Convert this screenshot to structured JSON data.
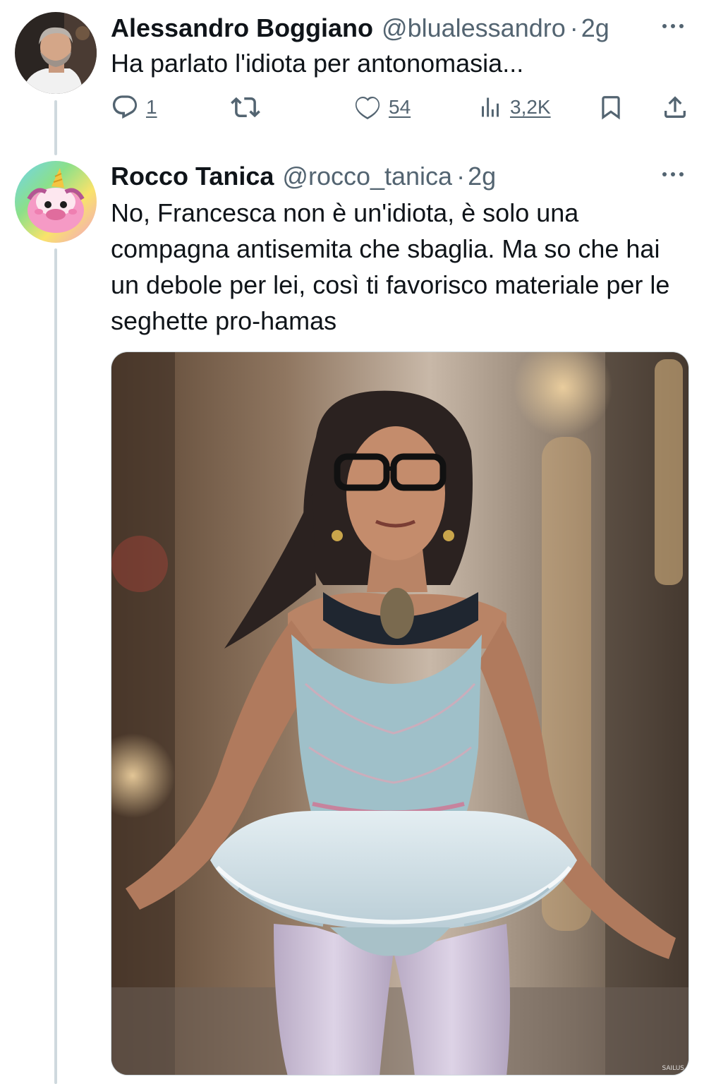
{
  "tweet_parent": {
    "author_name": "Alessandro Boggiano",
    "author_handle": "@blualessandro",
    "separator": "·",
    "time": "2g",
    "text": "Ha parlato l'idiota per antonomasia...",
    "avatar_icon": "avatar-photo-man",
    "more_icon": "more-horizontal-icon",
    "actions": {
      "reply": {
        "icon": "reply-icon",
        "count": "1"
      },
      "retweet": {
        "icon": "retweet-icon",
        "count": ""
      },
      "like": {
        "icon": "heart-icon",
        "count": "54"
      },
      "views": {
        "icon": "views-icon",
        "count": "3,2K"
      },
      "bookmark": {
        "icon": "bookmark-icon"
      },
      "share": {
        "icon": "share-icon"
      }
    }
  },
  "tweet_reply": {
    "author_name": "Rocco Tanica",
    "author_handle": "@rocco_tanica",
    "separator": "·",
    "time": "2g",
    "text": "No, Francesca non è un'idiota, è solo una compagna antisemita che sbaglia. Ma so che hai un debole per lei, così ti favorisco materiale per le seghette pro-hamas",
    "avatar_icon": "avatar-pink-unicorn",
    "more_icon": "more-horizontal-icon",
    "media": {
      "description_icon": "photo-ballerina-tutu",
      "watermark": "SAILUS"
    }
  },
  "colors": {
    "text_primary": "#0f1419",
    "text_secondary": "#536471",
    "thread_line": "#cfd9de",
    "background": "#ffffff"
  }
}
